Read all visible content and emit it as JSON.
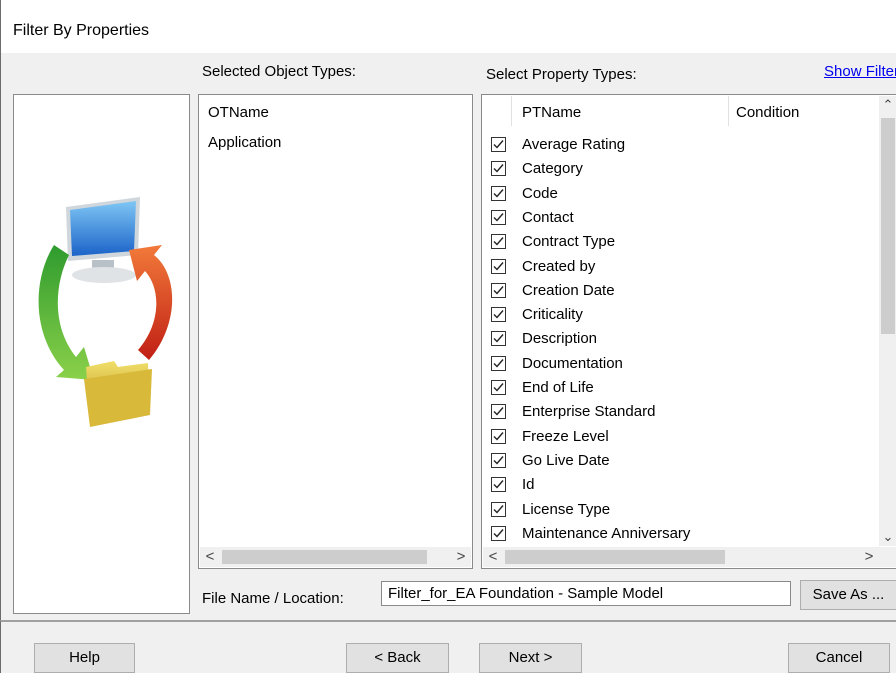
{
  "dialog": {
    "title": "Filter By Properties"
  },
  "object_types": {
    "label": "Selected Object Types:",
    "column": "OTName",
    "items": [
      "Application"
    ]
  },
  "property_types": {
    "label": "Select Property Types:",
    "show_filter_link": "Show Filter",
    "columns": {
      "name": "PTName",
      "condition": "Condition"
    },
    "items": [
      {
        "name": "Average Rating",
        "checked": true
      },
      {
        "name": "Category",
        "checked": true
      },
      {
        "name": "Code",
        "checked": true
      },
      {
        "name": "Contact",
        "checked": true
      },
      {
        "name": "Contract Type",
        "checked": true
      },
      {
        "name": "Created by",
        "checked": true
      },
      {
        "name": "Creation Date",
        "checked": true
      },
      {
        "name": "Criticality",
        "checked": true
      },
      {
        "name": "Description",
        "checked": true
      },
      {
        "name": "Documentation",
        "checked": true
      },
      {
        "name": "End of Life",
        "checked": true
      },
      {
        "name": "Enterprise Standard",
        "checked": true
      },
      {
        "name": "Freeze Level",
        "checked": true
      },
      {
        "name": "Go Live Date",
        "checked": true
      },
      {
        "name": "Id",
        "checked": true
      },
      {
        "name": "License Type",
        "checked": true
      },
      {
        "name": "Maintenance Anniversary",
        "checked": true
      }
    ]
  },
  "file": {
    "label": "File Name / Location:",
    "value": "Filter_for_EA Foundation - Sample Model",
    "save_as": "Save As ..."
  },
  "buttons": {
    "help": "Help",
    "back": "< Back",
    "next": "Next >",
    "cancel": "Cancel"
  }
}
